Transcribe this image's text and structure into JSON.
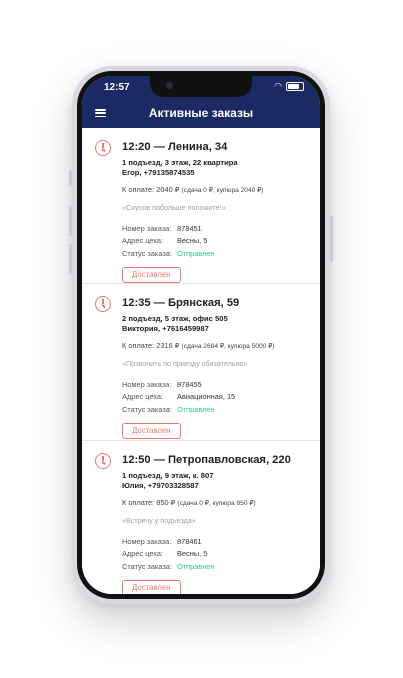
{
  "status_bar": {
    "time": "12:57"
  },
  "header": {
    "title": "Активные заказы",
    "menu_icon": "hamburger-menu-icon"
  },
  "labels": {
    "order_number": "Номер заказа:",
    "shop_address": "Адрес цеха:",
    "order_status": "Статус заказа:",
    "deliver_button": "Доставлен"
  },
  "colors": {
    "header_bg": "#1b2a63",
    "accent": "#e97b6e",
    "status_sent": "#36c48e"
  },
  "orders": [
    {
      "headline": "12:20 — Ленина, 34",
      "address_line": "1 подъезд, 3 этаж, 22 квартира",
      "customer": "Егор, +79135874535",
      "payment": "К оплате: 2040 ₽",
      "change": "(сдача 0 ₽, купюра 2040 ₽)",
      "comment": "«Соусов побольше положите!»",
      "order_number": "878451",
      "shop_address": "Весны, 5",
      "status": "Отправлен"
    },
    {
      "headline": "12:35 — Брянская, 59",
      "address_line": "2 подъезд, 5 этаж, офис 505",
      "customer": "Виктория, +7616459987",
      "payment": "К оплате: 2316 ₽",
      "change": "(сдача 2684 ₽, купюра 5000 ₽)",
      "comment": "«Позвонить по приезду обязательно»",
      "order_number": "878455",
      "shop_address": "Авиационная, 15",
      "status": "Отправлен"
    },
    {
      "headline": "12:50 — Петропавловская, 220",
      "address_line": "1 подъезд, 9 этаж, к. 807",
      "customer": "Юлия, +79703328587",
      "payment": "К оплате: 850 ₽",
      "change": "(сдача 0 ₽, купюра 850 ₽)",
      "comment": "«Встречу у подъезда»",
      "order_number": "878461",
      "shop_address": "Весны, 5",
      "status": "Отправлен"
    }
  ]
}
